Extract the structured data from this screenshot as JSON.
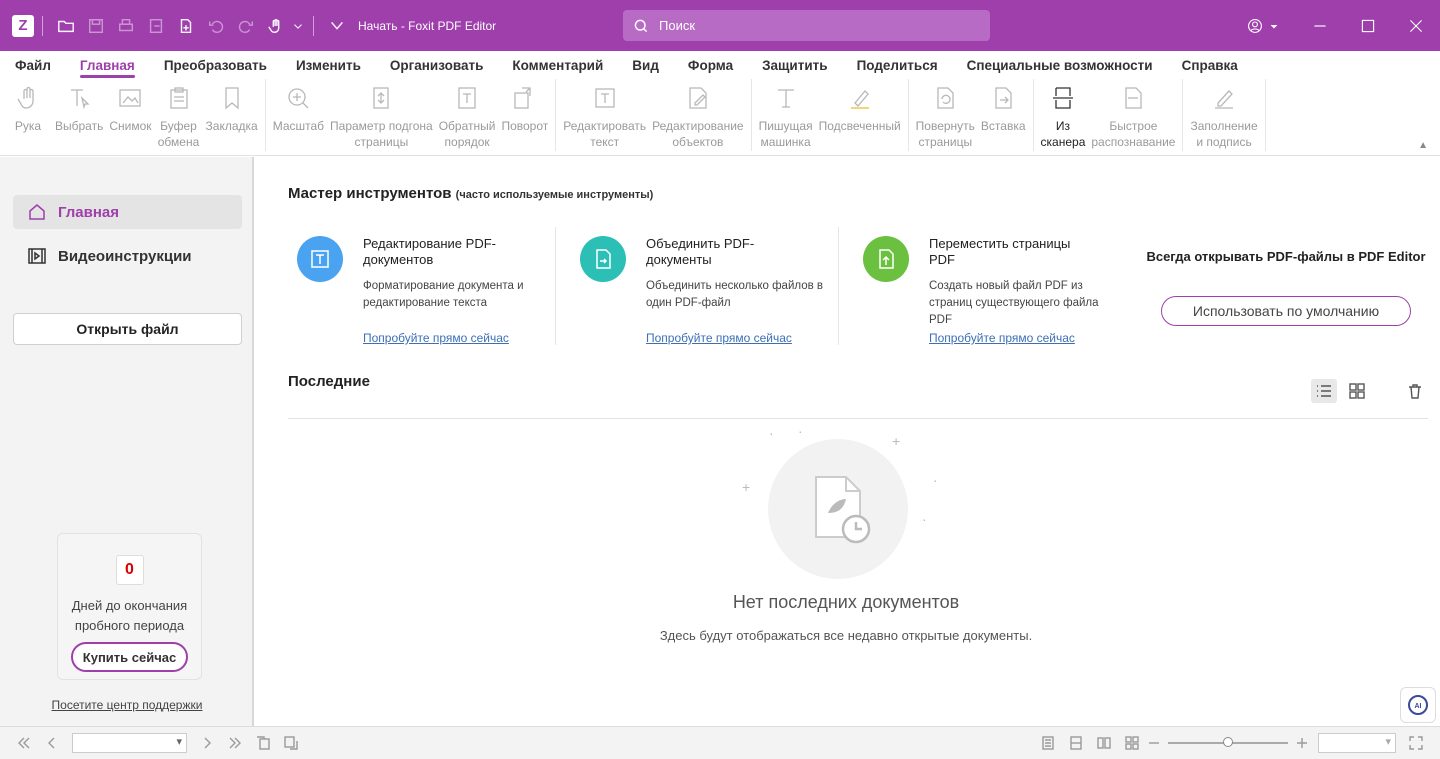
{
  "window": {
    "title": "Начать - Foxit PDF Editor"
  },
  "search": {
    "placeholder": "Поиск"
  },
  "colors": {
    "brand": "#9e3fab",
    "link": "#3d6fb5",
    "card1": "#4aa3f0",
    "card2": "#2bbfb5",
    "card3": "#6cc040"
  },
  "menu": {
    "tabs": [
      "Файл",
      "Главная",
      "Преобразовать",
      "Изменить",
      "Организовать",
      "Комментарий",
      "Вид",
      "Форма",
      "Защитить",
      "Поделиться",
      "Специальные возможности",
      "Справка"
    ],
    "active": "Главная"
  },
  "ribbon": {
    "hand": "Рука",
    "select": "Выбрать",
    "snapshot": "Снимок",
    "clipboard": "Буфер\nобмена",
    "bookmark": "Закладка",
    "zoom": "Масштаб",
    "fit": "Параметр подгона\nстраницы",
    "reverse": "Обратный\nпорядок",
    "rotate": "Поворот",
    "edit_text": "Редактировать\nтекст",
    "edit_objects": "Редактирование\nобъектов",
    "typewriter": "Пишущая\nмашинка",
    "highlight": "Подсвеченный",
    "rotate_pages": "Повернуть\nстраницы",
    "insert": "Вставка",
    "scanner": "Из\nсканера",
    "ocr": "Быстрое\nраспознавание",
    "fill_sign": "Заполнение\nи подпись"
  },
  "sidebar": {
    "home": "Главная",
    "videos": "Видеоинструкции",
    "open_file": "Открыть файл",
    "trial_days": "0",
    "trial_text": "Дней до окончания пробного периода",
    "buy": "Купить сейчас",
    "support": "Посетите центр поддержки"
  },
  "main": {
    "wizard_title": "Мастер инструментов",
    "wizard_sub": "(часто используемые инструменты)",
    "cards": [
      {
        "name": "Редактирование PDF-документов",
        "desc": "Форматирование документа и редактирование текста",
        "try": "Попробуйте прямо сейчас",
        "icon": "edit-text-icon"
      },
      {
        "name": "Объединить PDF-документы",
        "desc": "Объединить несколько файлов в один PDF-файл",
        "try": "Попробуйте прямо сейчас",
        "icon": "merge-icon"
      },
      {
        "name": "Переместить страницы PDF",
        "desc": "Создать новый файл PDF из страниц существующего файла PDF",
        "try": "Попробуйте прямо сейчас",
        "icon": "move-pages-icon"
      }
    ],
    "default_question": "Всегда открывать PDF-файлы в PDF Editor",
    "default_button": "Использовать по умолчанию",
    "recent_title": "Последние",
    "empty_title": "Нет последних документов",
    "empty_sub": "Здесь будут отображаться все недавно открытые документы."
  }
}
